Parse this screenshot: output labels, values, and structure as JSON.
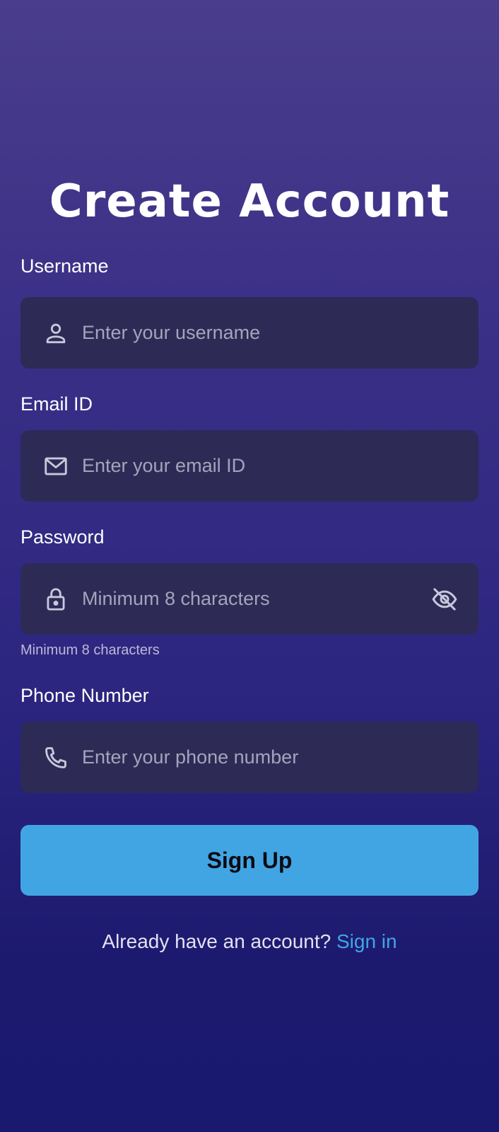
{
  "title": "Create Account",
  "fields": {
    "username": {
      "label": "Username",
      "placeholder": "Enter your username",
      "icon": "person-icon"
    },
    "email": {
      "label": "Email ID",
      "placeholder": "Enter your email ID",
      "icon": "mail-icon"
    },
    "password": {
      "label": "Password",
      "placeholder": "Minimum 8 characters",
      "icon": "lock-icon",
      "toggle_icon": "eye-off-icon",
      "hint": "Minimum 8 characters"
    },
    "phone": {
      "label": "Phone Number",
      "placeholder": "Enter your phone number",
      "icon": "phone-icon"
    }
  },
  "signup_button": "Sign Up",
  "footer": {
    "prompt": "Already have an account? ",
    "link": "Sign in"
  },
  "colors": {
    "background_top": "#4a3d8c",
    "background_bottom": "#191970",
    "field_bg": "#2d2b55",
    "accent": "#42a5e3",
    "placeholder": "#a6a3bd"
  }
}
